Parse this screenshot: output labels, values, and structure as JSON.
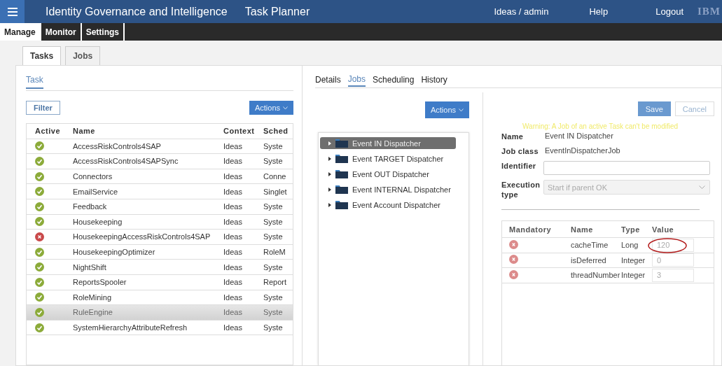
{
  "header": {
    "title": "Identity Governance and Intelligence",
    "app": "Task Planner",
    "user": "Ideas / admin",
    "help": "Help",
    "logout": "Logout",
    "logo": "IBM"
  },
  "nav": [
    {
      "label": "Manage",
      "selected": true
    },
    {
      "label": "Monitor",
      "selected": false
    },
    {
      "label": "Settings",
      "selected": false
    }
  ],
  "subtabs": [
    {
      "label": "Tasks",
      "selected": true
    },
    {
      "label": "Jobs",
      "selected": false
    }
  ],
  "task_panel": {
    "tab": "Task",
    "filter": "Filter",
    "actions": "Actions",
    "columns": [
      "Active",
      "Name",
      "Context",
      "Sched"
    ],
    "rows": [
      {
        "active": true,
        "name": "AccessRiskControls4SAP",
        "context": "Ideas",
        "schedule": "Syste",
        "selected": false
      },
      {
        "active": true,
        "name": "AccessRiskControls4SAPSync",
        "context": "Ideas",
        "schedule": "Syste",
        "selected": false
      },
      {
        "active": true,
        "name": "Connectors",
        "context": "Ideas",
        "schedule": "Conne",
        "selected": false
      },
      {
        "active": true,
        "name": "EmailService",
        "context": "Ideas",
        "schedule": "Singlet",
        "selected": false
      },
      {
        "active": true,
        "name": "Feedback",
        "context": "Ideas",
        "schedule": "Syste",
        "selected": false
      },
      {
        "active": true,
        "name": "Housekeeping",
        "context": "Ideas",
        "schedule": "Syste",
        "selected": false
      },
      {
        "active": false,
        "name": "HousekeepingAccessRiskControls4SAP",
        "context": "Ideas",
        "schedule": "Syste",
        "selected": false
      },
      {
        "active": true,
        "name": "HousekeepingOptimizer",
        "context": "Ideas",
        "schedule": "RoleM",
        "selected": false
      },
      {
        "active": true,
        "name": "NightShift",
        "context": "Ideas",
        "schedule": "Syste",
        "selected": false
      },
      {
        "active": true,
        "name": "ReportsSpooler",
        "context": "Ideas",
        "schedule": "Report",
        "selected": false
      },
      {
        "active": true,
        "name": "RoleMining",
        "context": "Ideas",
        "schedule": "Syste",
        "selected": false
      },
      {
        "active": true,
        "name": "RuleEngine",
        "context": "Ideas",
        "schedule": "Syste",
        "selected": true
      },
      {
        "active": true,
        "name": "SystemHierarchyAttributeRefresh",
        "context": "Ideas",
        "schedule": "Syste",
        "selected": false
      }
    ]
  },
  "detail_tabs": [
    {
      "label": "Details",
      "selected": false
    },
    {
      "label": "Jobs",
      "selected": true
    },
    {
      "label": "Scheduling",
      "selected": false
    },
    {
      "label": "History",
      "selected": false
    }
  ],
  "jobs": {
    "actions": "Actions",
    "tree": [
      {
        "label": "Event IN Dispatcher",
        "selected": true
      },
      {
        "label": "Event TARGET Dispatcher",
        "selected": false
      },
      {
        "label": "Event OUT Dispatcher",
        "selected": false
      },
      {
        "label": "Event INTERNAL Dispatcher",
        "selected": false
      },
      {
        "label": "Event Account Dispatcher",
        "selected": false
      }
    ]
  },
  "job_detail": {
    "save": "Save",
    "cancel": "Cancel",
    "warning": "Warning: A Job of an active Task can't be modified",
    "name_label": "Name",
    "name": "Event IN Dispatcher",
    "class_label": "Job class",
    "class": "EventInDispatcherJob",
    "identifier_label": "Identifier",
    "execution_label": "Execution type",
    "execution": "Start if parent OK",
    "param_columns": [
      "Mandatory",
      "Name",
      "Type",
      "Value"
    ],
    "params": [
      {
        "mandatory": false,
        "name": "cacheTime",
        "type": "Long",
        "value": "120",
        "circled": true
      },
      {
        "mandatory": false,
        "name": "isDeferred",
        "type": "Integer",
        "value": "0",
        "circled": false
      },
      {
        "mandatory": false,
        "name": "threadNumber",
        "type": "Integer",
        "value": "3",
        "circled": false
      }
    ]
  }
}
